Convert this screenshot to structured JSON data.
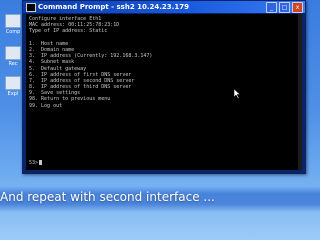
{
  "desktop": {
    "icons": [
      {
        "label": "Comp"
      },
      {
        "label": "Rec"
      },
      {
        "label": "Expl"
      }
    ]
  },
  "window": {
    "title": "Command Prompt - ssh2 10.24.23.179",
    "buttons": {
      "minimize": "_",
      "maximize": "□",
      "close": "x"
    }
  },
  "console": {
    "lines": [
      "Configure interface Eth1",
      "MAC address: 00:11:25:78:23:1D",
      "Type of IP address: Static",
      "",
      "1.  Host name",
      "2.  Domain name",
      "3.  IP address (Currently: 192.168.3.147)",
      "4.  Subnet mask",
      "5.  Default gateway",
      "6.  IP address of first DNS server",
      "7.  IP address of second DNS server",
      "8.  IP address of third DNS server",
      "9.  Save settings",
      "98. Return to previous menu",
      "99. Log out"
    ],
    "prompt": "53>"
  },
  "caption": {
    "text": "And repeat with second interface ..."
  }
}
